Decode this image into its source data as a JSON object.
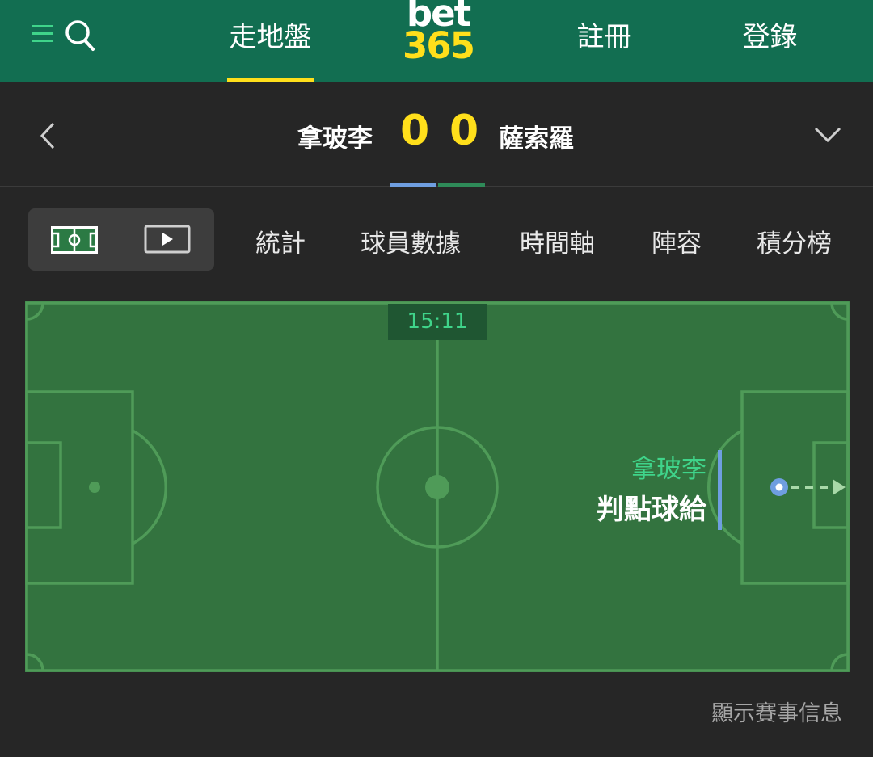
{
  "header": {
    "nav_active": "走地盤",
    "register": "註冊",
    "login": "登錄",
    "logo_top": "bet",
    "logo_bottom": "365",
    "brand_yellow": "#ffdf1b",
    "brand_green": "#126e51"
  },
  "match": {
    "home_team": "拿玻李",
    "away_team": "薩索羅",
    "home_score": "0",
    "away_score": "0",
    "home_color": "#6f9ee0",
    "away_color": "#2e8a58"
  },
  "tabs": {
    "view_options": [
      "pitch-view-icon",
      "video-view-icon"
    ],
    "stats": "統計",
    "player_data": "球員數據",
    "timeline": "時間軸",
    "lineup": "陣容",
    "standings": "積分榜"
  },
  "pitch": {
    "clock": "15:11",
    "event_team": "拿玻李",
    "event_description": "判點球給",
    "accent": "#3fd48a"
  },
  "footer": {
    "show_match_info": "顯示賽事信息"
  }
}
